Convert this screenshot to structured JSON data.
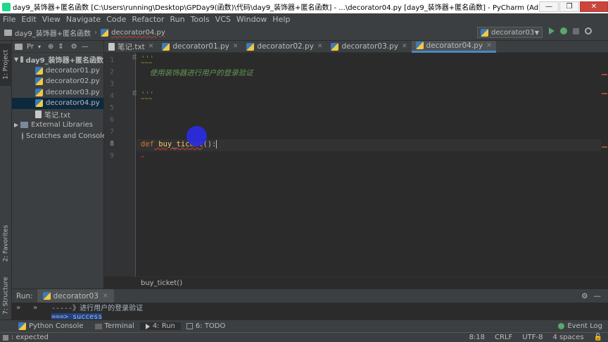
{
  "window": {
    "title": "day9_装饰器+匿名函数 [C:\\Users\\running\\Desktop\\GPDay9(函数)\\代码\\day9_装饰器+匿名函数] - ...\\decorator04.py [day9_装饰器+匿名函数] - PyCharm (Administrator)",
    "minimize": "—",
    "restore": "❐",
    "close": "✕"
  },
  "menu": [
    "File",
    "Edit",
    "View",
    "Navigate",
    "Code",
    "Refactor",
    "Run",
    "Tools",
    "VCS",
    "Window",
    "Help"
  ],
  "nav": {
    "project": "day9_装饰器+匿名函数",
    "file": "decorator04.py",
    "run_config": "decorator03"
  },
  "side_tabs": {
    "project": "1: Project",
    "favorites": "2: Favorites",
    "structure": "7: Structure"
  },
  "project_panel": {
    "title": "Pr",
    "root": "day9_装饰器+匿名函数",
    "files": [
      "decorator01.py",
      "decorator02.py",
      "decorator03.py",
      "decorator04.py",
      "笔记.txt"
    ],
    "selected_index": 3,
    "external": "External Libraries",
    "scratches": "Scratches and Console"
  },
  "editor_tabs": [
    {
      "label": "笔记.txt",
      "active": false,
      "kind": "txt"
    },
    {
      "label": "decorator01.py",
      "active": false,
      "kind": "py"
    },
    {
      "label": "decorator02.py",
      "active": false,
      "kind": "py"
    },
    {
      "label": "decorator03.py",
      "active": false,
      "kind": "py"
    },
    {
      "label": "decorator04.py",
      "active": true,
      "kind": "py"
    }
  ],
  "line_numbers": [
    "1",
    "2",
    "3",
    "4",
    "5",
    "6",
    "7",
    "8",
    "9"
  ],
  "code": {
    "line1": "'''",
    "line2": "  使用装饰器进行用户的登录验证",
    "line4": "'''",
    "line8_kw": "def",
    "line8_name": " buy_ticket",
    "line8_rest": "():"
  },
  "breadcrumb": "buy_ticket()",
  "run": {
    "label": "Run:",
    "tab": "decorator03",
    "out1": "-----》进行用户的登录验证",
    "out2": "===> success"
  },
  "bottom_tools": [
    "Python Console",
    "Terminal",
    "4: Run",
    "6: TODO"
  ],
  "event_log": "Event Log",
  "status": {
    "left": ": expected",
    "pos": "8:18",
    "crlf": "CRLF",
    "enc": "UTF-8",
    "indent": "4 spaces"
  },
  "colors": {
    "keyword": "#cc7832",
    "funcname": "#ffc66d",
    "docstring": "#629755",
    "active_tab_underline": "#4a88c7"
  }
}
